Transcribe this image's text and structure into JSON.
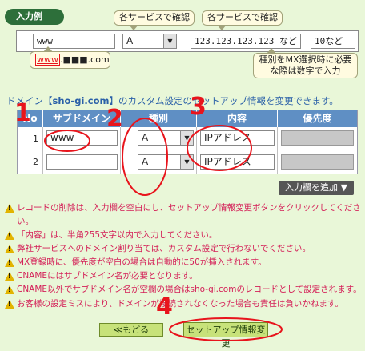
{
  "example": {
    "section_label": "入力例",
    "tooltip_confirm_1": "各サービスで確認",
    "tooltip_confirm_2": "各サービスで確認",
    "tooltip_domain": "www.■■■.com",
    "tooltip_domain_hl": "www",
    "tooltip_domain_rest": ".■■■.com",
    "tooltip_mx": "種別をMX選択時に必要な際は数字で入力",
    "subdomain_value": "www",
    "type_value": "A",
    "content_value": "123.123.123.123 など",
    "priority_value": "10など"
  },
  "description": {
    "prefix": "ドメイン【",
    "domain": "sho-gi.com",
    "suffix": "】のカスタム設定のセットアップ情報を変更できます。"
  },
  "table": {
    "headers": [
      "No",
      "サブドメイン",
      "種別",
      "内容",
      "優先度"
    ],
    "rows": [
      {
        "no": "1",
        "subdomain": "www",
        "type": "A",
        "content": "IPアドレス",
        "priority": ""
      },
      {
        "no": "2",
        "subdomain": "",
        "type": "A",
        "content": "IPアドレス",
        "priority": ""
      }
    ]
  },
  "add_row_label": "入力欄を追加 ▼",
  "notes": [
    "レコードの削除は、入力欄を空白にし、セットアップ情報変更ボタンをクリックしてください。",
    "「内容」は、半角255文字以内で入力してください。",
    "弊社サービスへのドメイン割り当ては、カスタム設定で行わないでください。",
    "MX登録時に、優先度が空白の場合は自動的に50が挿入されます。",
    "CNAMEにはサブドメイン名が必要となります。",
    "CNAME以外でサブドメイン名が空欄の場合はsho-gi.comのレコードとして設定されます。",
    "お客様の設定ミスにより、ドメインが接続されなくなった場合も責任は負いかねます。"
  ],
  "buttons": {
    "back": "≪もどる",
    "submit": "セットアップ情報変更"
  },
  "annotations": [
    "1",
    "2",
    "3",
    "4"
  ],
  "colors": {
    "annotation_red": "#e8141c",
    "header_blue": "#5f8fc4",
    "note_pink": "#d41f57",
    "background": "#e9f7d8",
    "button_green": "#c7e27a"
  }
}
